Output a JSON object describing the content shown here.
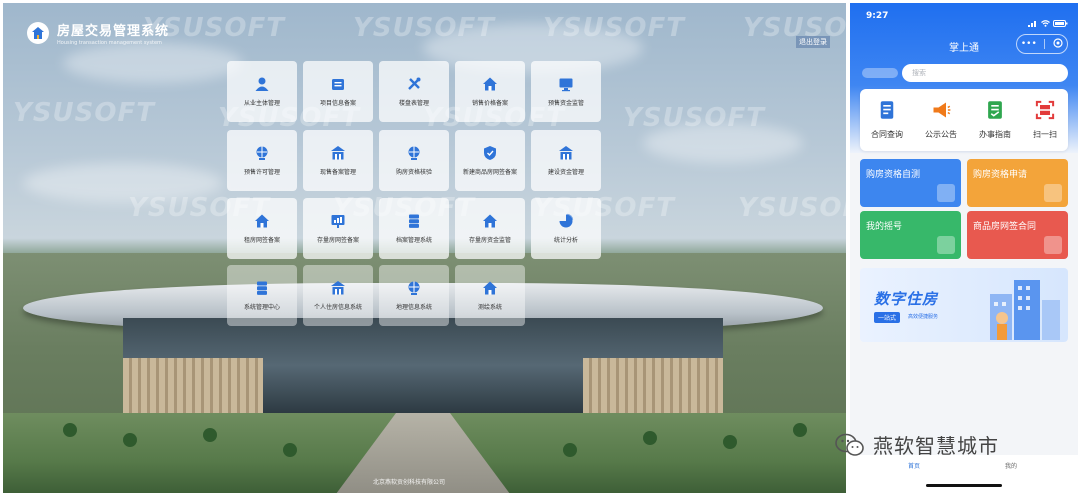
{
  "desktop": {
    "system_title": "房屋交易管理系统",
    "system_subtitle": "Housing transaction management system",
    "logout_label": "退出登录",
    "watermark_text": "YSUSOFT",
    "watermark_brand": "燕软",
    "copyright": "北京燕软贡创科技有限公司",
    "tiles": [
      {
        "label": "从业主体管理",
        "icon": "user-icon"
      },
      {
        "label": "项目信息备案",
        "icon": "folder-icon"
      },
      {
        "label": "楼盘表管理",
        "icon": "tools-icon"
      },
      {
        "label": "销售价格备案",
        "icon": "house-icon"
      },
      {
        "label": "预售资金监管",
        "icon": "monitor-icon"
      },
      {
        "label": "预售许可管理",
        "icon": "globe-icon"
      },
      {
        "label": "现售备案管理",
        "icon": "building-icon"
      },
      {
        "label": "购房资格核验",
        "icon": "globe-icon"
      },
      {
        "label": "新建商品房网签备案",
        "icon": "shield-icon"
      },
      {
        "label": "建设资金管理",
        "icon": "building-icon"
      },
      {
        "label": "租房网签备案",
        "icon": "house-icon"
      },
      {
        "label": "存量房网签备案",
        "icon": "chart-board-icon"
      },
      {
        "label": "档案管理系统",
        "icon": "stack-icon"
      },
      {
        "label": "存量房资金监管",
        "icon": "house-icon"
      },
      {
        "label": "统计分析",
        "icon": "pie-chart-icon"
      },
      {
        "label": "系统管理中心",
        "icon": "stack-icon"
      },
      {
        "label": "个人住房信息系统",
        "icon": "building-icon"
      },
      {
        "label": "地理信息系统",
        "icon": "globe-icon"
      },
      {
        "label": "测绘系统",
        "icon": "house-icon"
      }
    ],
    "accent_color": "#2f74d8"
  },
  "phone": {
    "time": "9:27",
    "title": "掌上通",
    "capsule_more": "•••",
    "search_placeholder": "搜索",
    "quick_actions": [
      {
        "label": "合同查询",
        "icon": "document-icon",
        "color": "#2f74d8"
      },
      {
        "label": "公示公告",
        "icon": "megaphone-icon",
        "color": "#f07a1a"
      },
      {
        "label": "办事指南",
        "icon": "guide-icon",
        "color": "#2fa64f"
      },
      {
        "label": "扫一扫",
        "icon": "scan-icon",
        "color": "#e23b3b"
      }
    ],
    "cards": [
      {
        "label": "购房资格自测",
        "color": "#3d86ef"
      },
      {
        "label": "购房资格申请",
        "color": "#f3a43a"
      },
      {
        "label": "我的摇号",
        "color": "#37b86a"
      },
      {
        "label": "商品房网签合同",
        "color": "#e8594f"
      }
    ],
    "banner": {
      "main": "数字住房",
      "tag": "一站式",
      "sub": "高效便捷服务"
    },
    "tabbar": {
      "home": "首页",
      "mine": "我的"
    }
  },
  "wechat_watermark": "燕软智慧城市"
}
